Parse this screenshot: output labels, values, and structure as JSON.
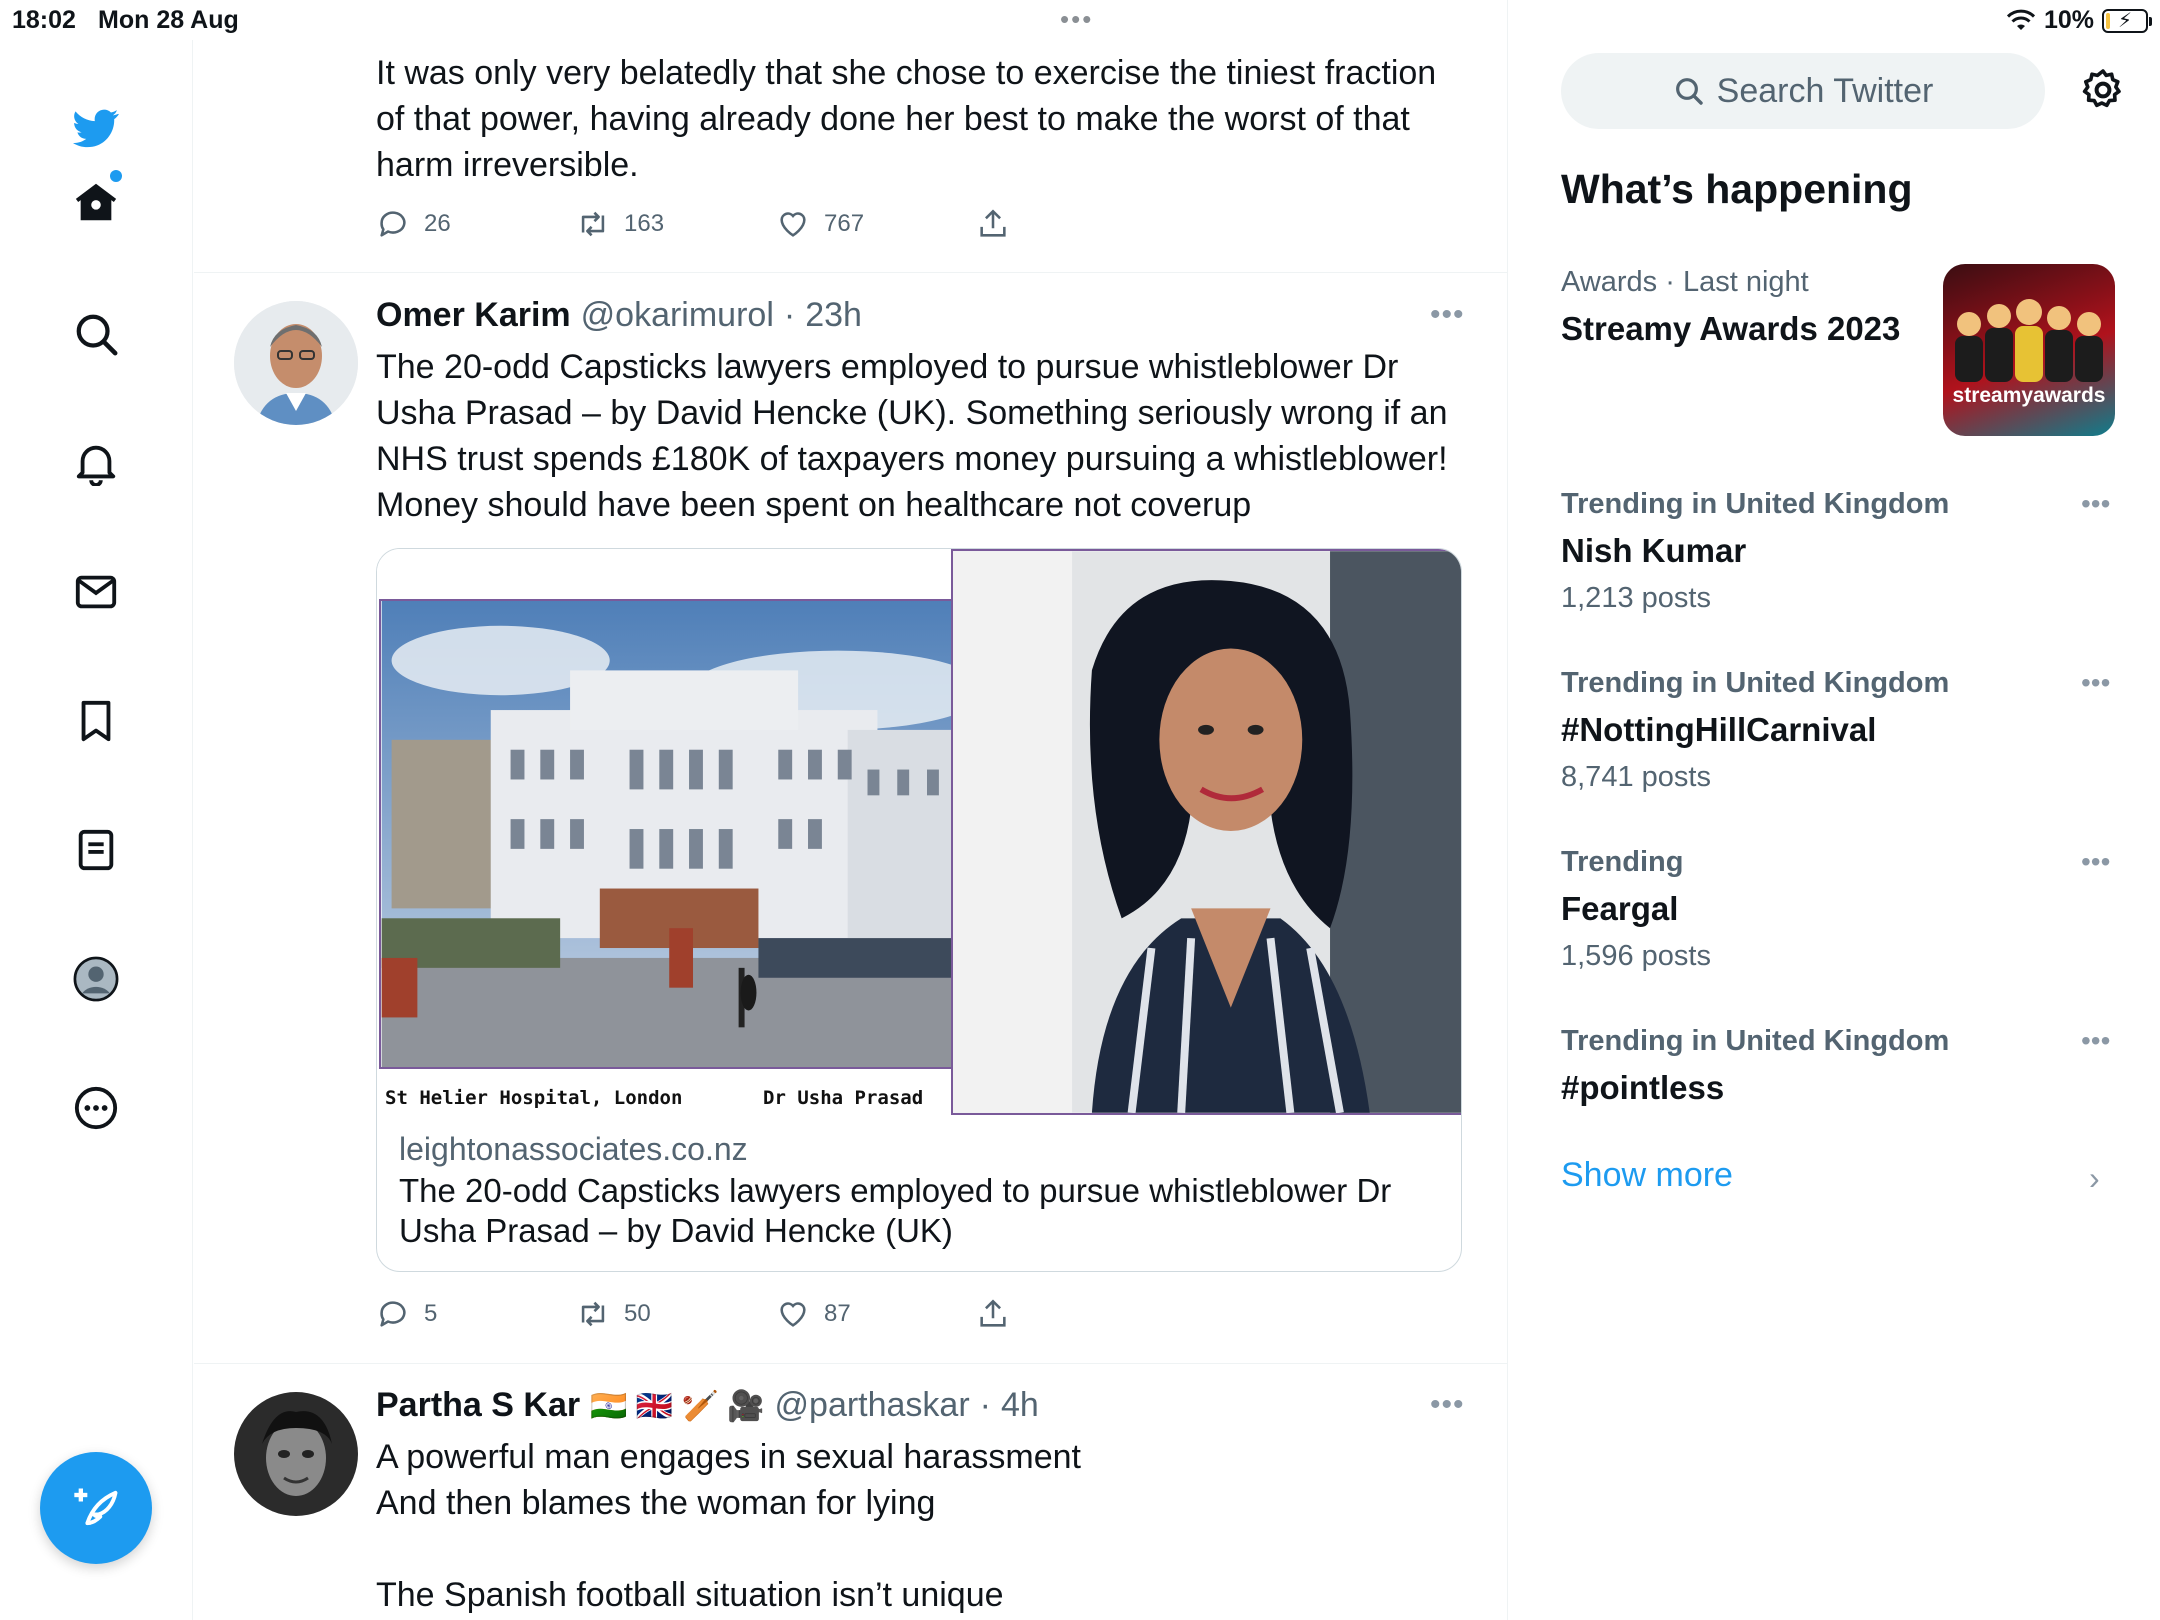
{
  "status_bar": {
    "time": "18:02",
    "date": "Mon 28 Aug",
    "battery": "10%",
    "battery_level": 0.1
  },
  "nav": {
    "items": [
      "home-icon",
      "search-icon",
      "bell-icon",
      "mail-icon",
      "bookmark-icon",
      "lists-icon",
      "profile-icon",
      "more-icon"
    ],
    "compose_icon": "compose-icon"
  },
  "timeline": {
    "tweet1": {
      "text_lines": [
        "It was only very belatedly that she chose to exercise the tiniest fraction",
        "of that power, having already done her best to make the worst of that",
        "harm irreversible."
      ],
      "replies": "26",
      "retweets": "163",
      "likes": "767"
    },
    "tweet2": {
      "name": "Omer Karim",
      "handle": "@okarimurol",
      "time": "23h",
      "text_lines": [
        "The 20-odd Capsticks lawyers employed to pursue whistleblower Dr",
        "Usha Prasad – by David Hencke (UK). Something seriously wrong if an",
        "NHS trust spends £180K of taxpayers money pursuing a whistleblower!",
        "Money should have been spent on healthcare not coverup"
      ],
      "card": {
        "caption_left": "St Helier Hospital, London",
        "caption_right": "Dr Usha Prasad",
        "domain": "leightonassociates.co.nz",
        "title_lines": [
          "The 20-odd Capsticks lawyers employed to pursue whistleblower Dr",
          "Usha Prasad – by David Hencke (UK)"
        ]
      },
      "replies": "5",
      "retweets": "50",
      "likes": "87"
    },
    "tweet3": {
      "name": "Partha S Kar",
      "name_emojis": "🇮🇳 🇬🇧 🏏 🎥",
      "handle": "@parthaskar",
      "time": "4h",
      "text_lines": [
        "A powerful man engages in sexual harassment",
        "And then blames the woman for lying",
        "",
        "The Spanish football situation isn’t unique"
      ]
    }
  },
  "sidebar": {
    "search_placeholder": "Search Twitter",
    "section_title": "What’s happening",
    "featured": {
      "category": "Awards",
      "meta": "Last night",
      "title": "Streamy Awards 2023",
      "image_label": "streamyawards"
    },
    "trends": [
      {
        "category": "Trending in United Kingdom",
        "name": "Nish Kumar",
        "count": "1,213 posts"
      },
      {
        "category": "Trending in United Kingdom",
        "name": "#NottingHillCarnival",
        "count": "8,741 posts"
      },
      {
        "category": "Trending",
        "name": "Feargal",
        "count": "1,596 posts"
      },
      {
        "category": "Trending in United Kingdom",
        "name": "#pointless",
        "count": ""
      }
    ],
    "show_more": "Show more"
  },
  "colors": {
    "accent": "#1d9bf0",
    "text": "#0f1419",
    "secondary": "#536471",
    "divider": "#eff3f4"
  }
}
